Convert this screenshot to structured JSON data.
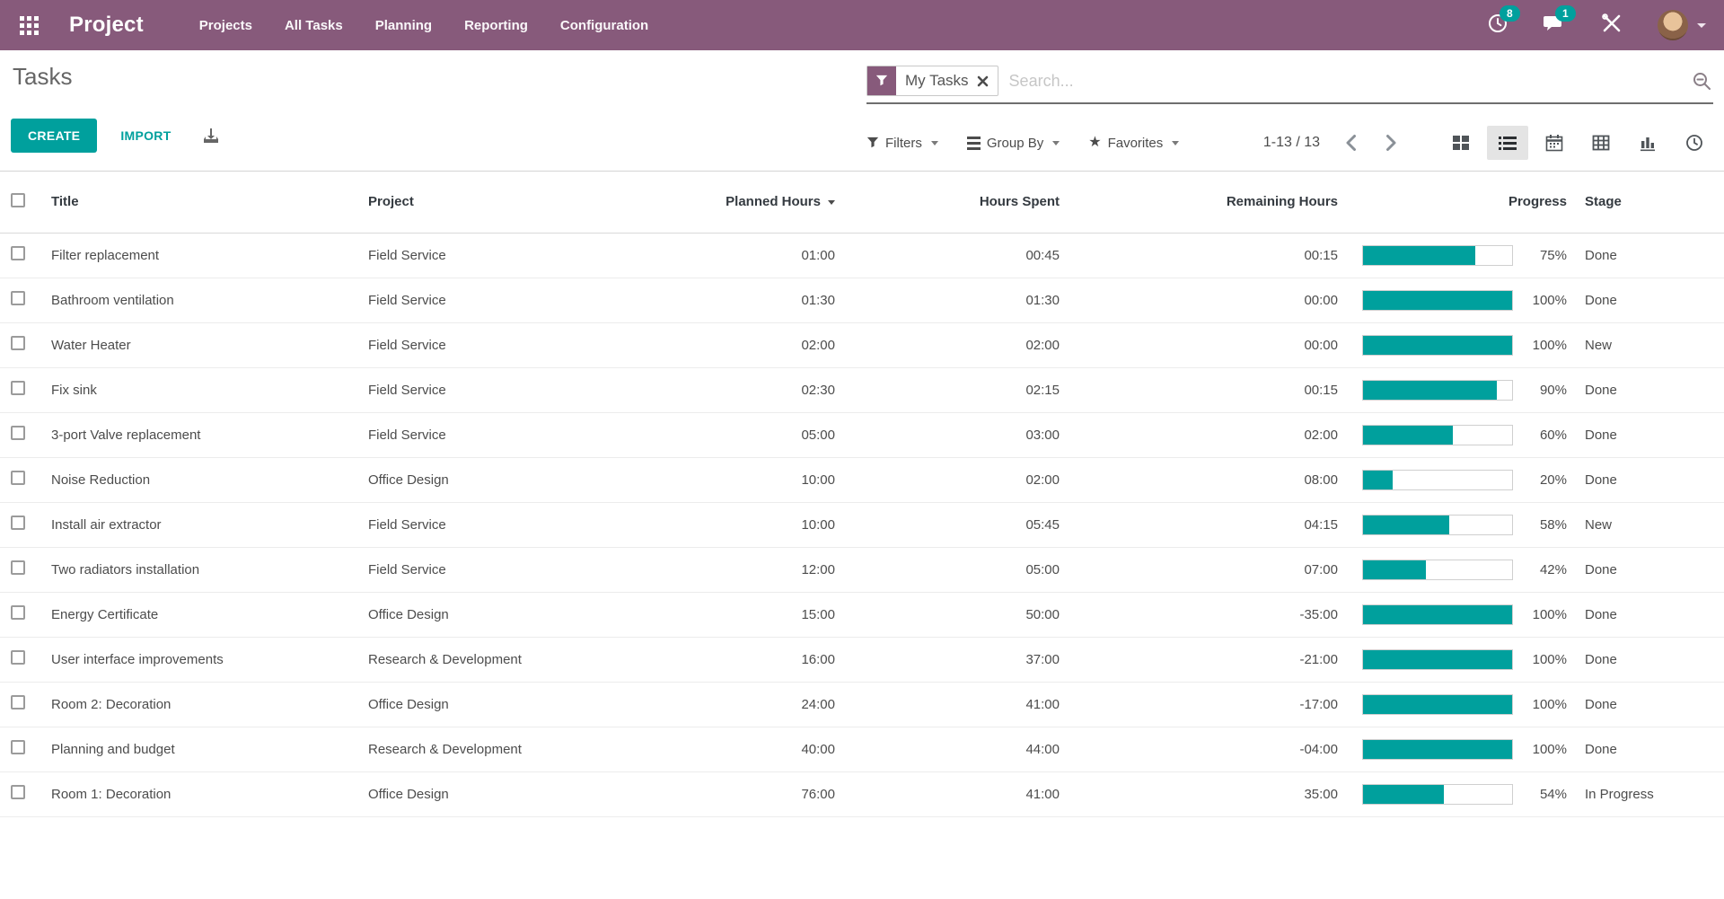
{
  "colors": {
    "primary": "#875A7B",
    "accent": "#00A09D"
  },
  "navbar": {
    "brand": "Project",
    "menus": [
      "Projects",
      "All Tasks",
      "Planning",
      "Reporting",
      "Configuration"
    ],
    "activity_badge": "8",
    "message_badge": "1"
  },
  "control_panel": {
    "breadcrumb": "Tasks",
    "create_label": "CREATE",
    "import_label": "IMPORT",
    "facet_label": "My Tasks",
    "search_placeholder": "Search...",
    "filters_label": "Filters",
    "group_by_label": "Group By",
    "favorites_label": "Favorites",
    "pager": "1-13 / 13"
  },
  "table": {
    "headers": {
      "title": "Title",
      "project": "Project",
      "planned": "Planned Hours",
      "spent": "Hours Spent",
      "remaining": "Remaining Hours",
      "progress": "Progress",
      "stage": "Stage"
    },
    "rows": [
      {
        "title": "Filter replacement",
        "project": "Field Service",
        "planned": "01:00",
        "spent": "00:45",
        "remaining": "00:15",
        "progress": 75,
        "progress_label": "75%",
        "stage": "Done"
      },
      {
        "title": "Bathroom ventilation",
        "project": "Field Service",
        "planned": "01:30",
        "spent": "01:30",
        "remaining": "00:00",
        "progress": 100,
        "progress_label": "100%",
        "stage": "Done"
      },
      {
        "title": "Water Heater",
        "project": "Field Service",
        "planned": "02:00",
        "spent": "02:00",
        "remaining": "00:00",
        "progress": 100,
        "progress_label": "100%",
        "stage": "New"
      },
      {
        "title": "Fix sink",
        "project": "Field Service",
        "planned": "02:30",
        "spent": "02:15",
        "remaining": "00:15",
        "progress": 90,
        "progress_label": "90%",
        "stage": "Done"
      },
      {
        "title": "3-port Valve replacement",
        "project": "Field Service",
        "planned": "05:00",
        "spent": "03:00",
        "remaining": "02:00",
        "progress": 60,
        "progress_label": "60%",
        "stage": "Done"
      },
      {
        "title": "Noise Reduction",
        "project": "Office Design",
        "planned": "10:00",
        "spent": "02:00",
        "remaining": "08:00",
        "progress": 20,
        "progress_label": "20%",
        "stage": "Done"
      },
      {
        "title": "Install air extractor",
        "project": "Field Service",
        "planned": "10:00",
        "spent": "05:45",
        "remaining": "04:15",
        "progress": 58,
        "progress_label": "58%",
        "stage": "New"
      },
      {
        "title": "Two radiators installation",
        "project": "Field Service",
        "planned": "12:00",
        "spent": "05:00",
        "remaining": "07:00",
        "progress": 42,
        "progress_label": "42%",
        "stage": "Done"
      },
      {
        "title": "Energy Certificate",
        "project": "Office Design",
        "planned": "15:00",
        "spent": "50:00",
        "remaining": "-35:00",
        "progress": 100,
        "progress_label": "100%",
        "stage": "Done"
      },
      {
        "title": "User interface improvements",
        "project": "Research & Development",
        "planned": "16:00",
        "spent": "37:00",
        "remaining": "-21:00",
        "progress": 100,
        "progress_label": "100%",
        "stage": "Done"
      },
      {
        "title": "Room 2: Decoration",
        "project": "Office Design",
        "planned": "24:00",
        "spent": "41:00",
        "remaining": "-17:00",
        "progress": 100,
        "progress_label": "100%",
        "stage": "Done"
      },
      {
        "title": "Planning and budget",
        "project": "Research & Development",
        "planned": "40:00",
        "spent": "44:00",
        "remaining": "-04:00",
        "progress": 100,
        "progress_label": "100%",
        "stage": "Done"
      },
      {
        "title": "Room 1: Decoration",
        "project": "Office Design",
        "planned": "76:00",
        "spent": "41:00",
        "remaining": "35:00",
        "progress": 54,
        "progress_label": "54%",
        "stage": "In Progress"
      }
    ]
  }
}
